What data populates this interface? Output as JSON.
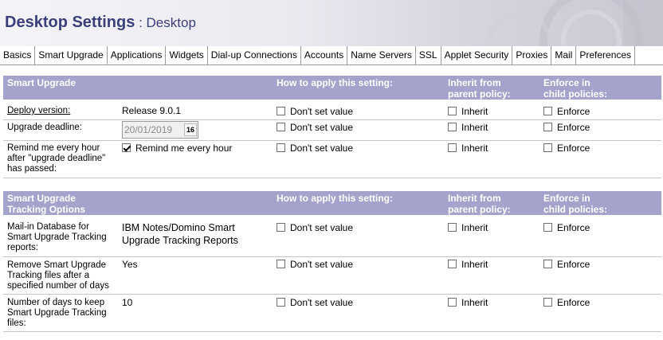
{
  "header": {
    "title": "Desktop Settings",
    "separator": " : ",
    "subtitle": "Desktop"
  },
  "tabs": [
    "Basics",
    "Smart Upgrade",
    "Applications",
    "Widgets",
    "Dial-up Connections",
    "Accounts",
    "Name Servers",
    "SSL",
    "Applet Security",
    "Proxies",
    "Mail",
    "Preferences"
  ],
  "active_tab": "Smart Upgrade",
  "columns": {
    "apply": "How to apply this setting:",
    "inherit_line1": "Inherit from",
    "inherit_line2": "parent policy:",
    "enforce_line1": "Enforce in",
    "enforce_line2": "child policies:"
  },
  "checkbox_labels": {
    "dont_set": "Don't set value",
    "inherit": "Inherit",
    "enforce": "Enforce"
  },
  "section1": {
    "title": "Smart Upgrade",
    "rows": [
      {
        "label": "Deploy version:",
        "value": "Release 9.0.1"
      },
      {
        "label": "Upgrade deadline:",
        "value": "20/01/2019",
        "calendar_label": "16"
      },
      {
        "label_lines": [
          "Remind me every hour",
          "after \"upgrade deadline\"",
          "has passed:"
        ],
        "value": "Remind me every hour",
        "checked": true
      }
    ]
  },
  "section2": {
    "title_lines": [
      "Smart Upgrade",
      "Tracking Options"
    ],
    "rows": [
      {
        "label_lines": [
          "Mail-in Database for",
          "Smart Upgrade Tracking",
          "reports:"
        ],
        "value_lines": [
          "IBM Notes/Domino Smart",
          "Upgrade Tracking Reports"
        ]
      },
      {
        "label_lines": [
          "Remove Smart Upgrade",
          "Tracking files after a",
          "specified number of days"
        ],
        "value": "Yes"
      },
      {
        "label_lines": [
          "Number of days to keep",
          "Smart Upgrade Tracking",
          "files:"
        ],
        "value": "10"
      }
    ]
  }
}
